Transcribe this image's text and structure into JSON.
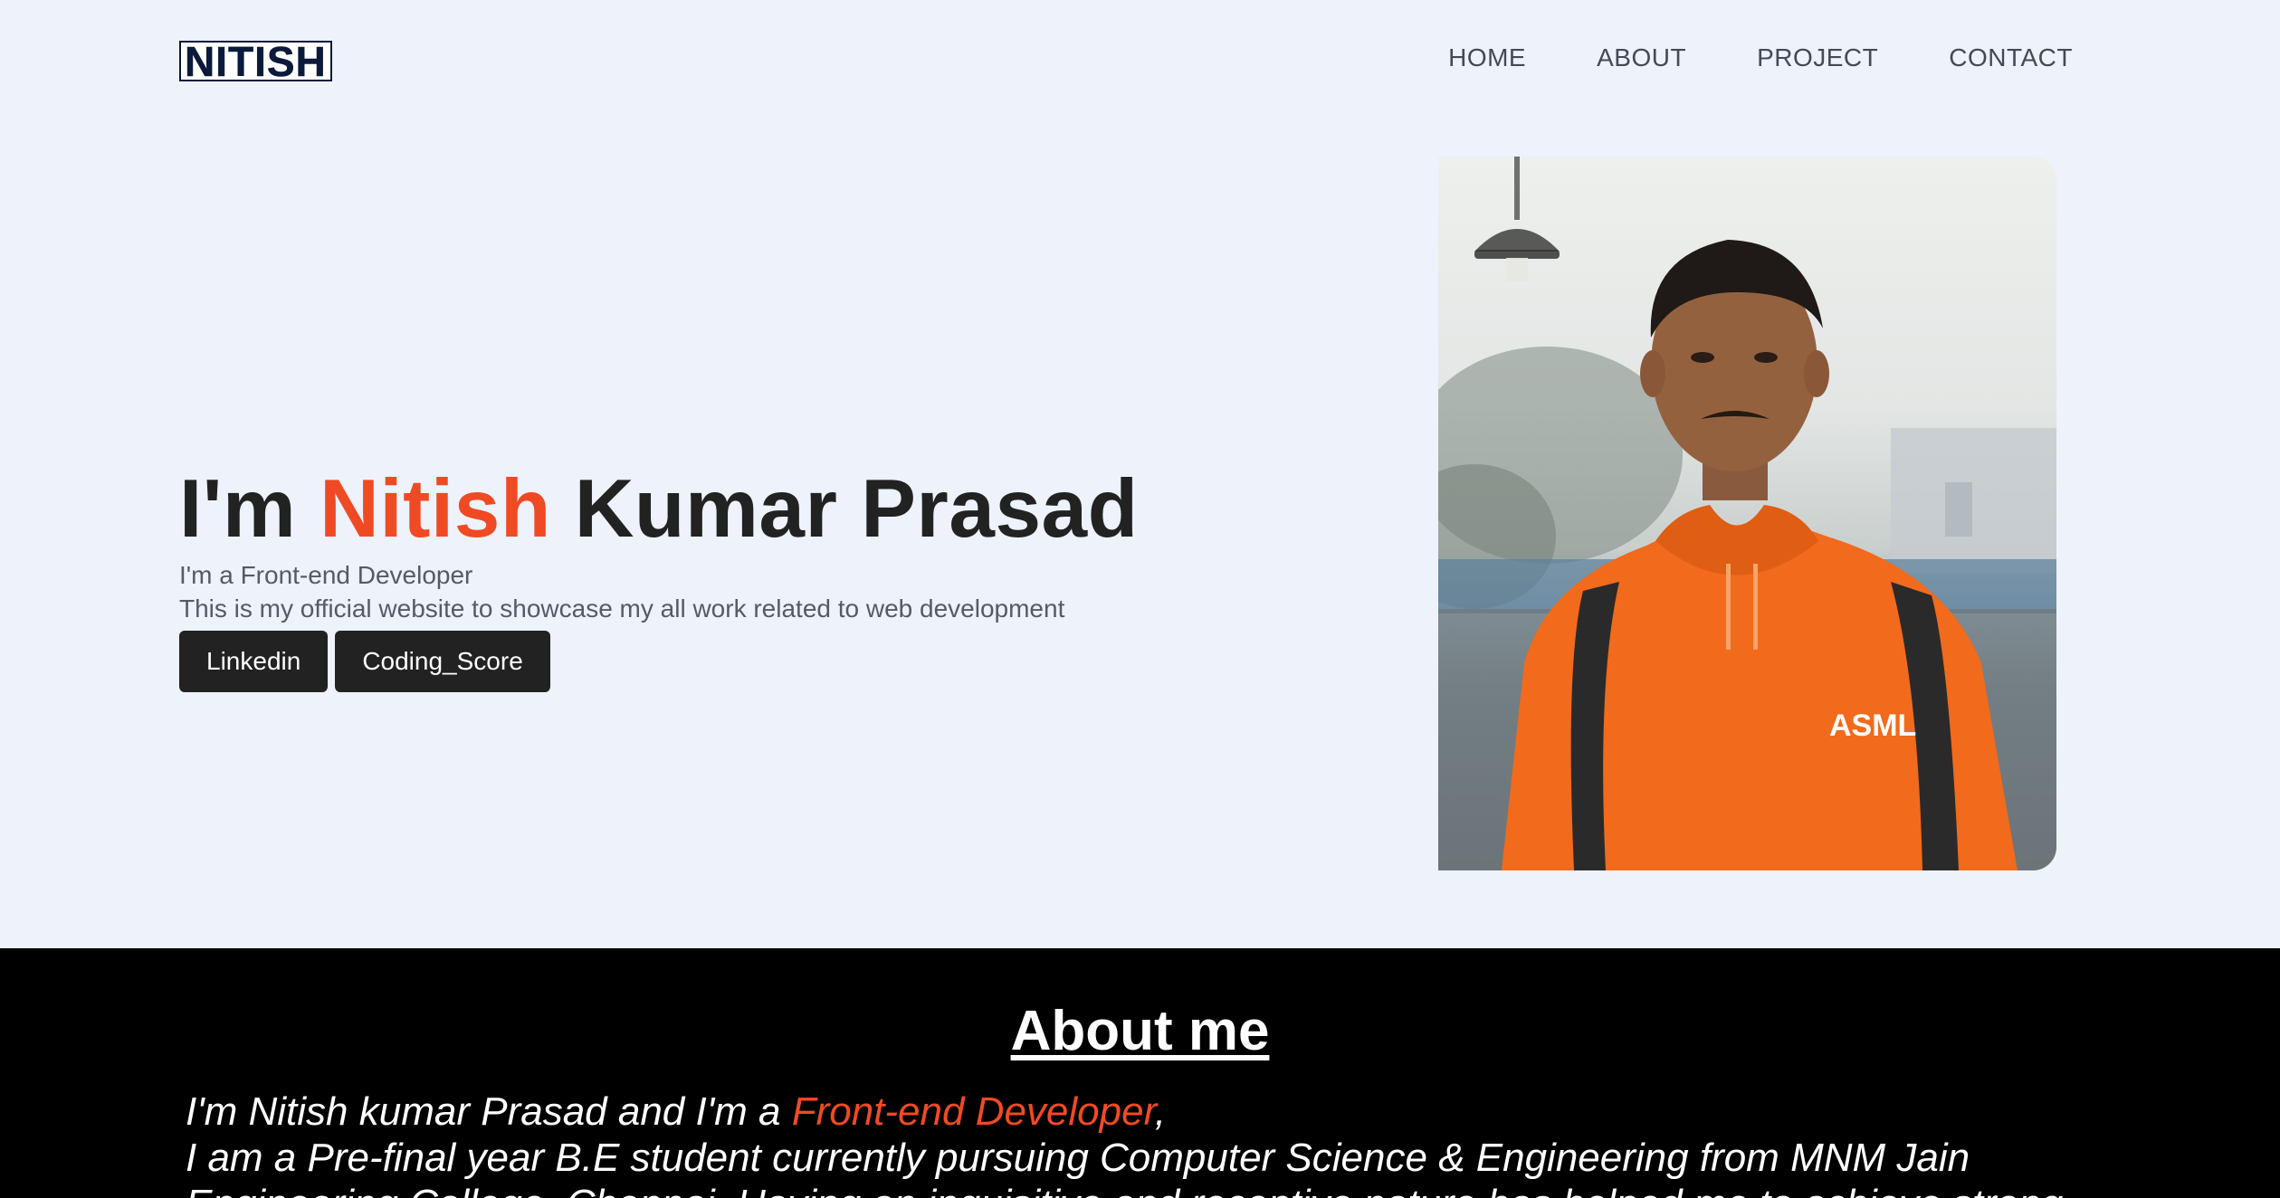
{
  "brand": {
    "logo_text": "NITISH"
  },
  "nav": {
    "items": [
      {
        "label": "HOME"
      },
      {
        "label": "ABOUT"
      },
      {
        "label": "PROJECT"
      },
      {
        "label": "CONTACT"
      }
    ]
  },
  "hero": {
    "title_prefix": "I'm ",
    "title_accent": "Nitish",
    "title_suffix": " Kumar Prasad",
    "role_line": "I'm a Front-end Developer",
    "description": "This is my official website to showcase my all work related to web development",
    "buttons": [
      {
        "label": "Linkedin"
      },
      {
        "label": "Coding_Score"
      }
    ],
    "photo_hoodie_text": "ASML"
  },
  "about": {
    "heading": "About me",
    "line1_prefix": "I'm Nitish kumar Prasad and I'm a ",
    "line1_accent": "Front-end Developer",
    "line1_suffix": ",",
    "line2": "I am a Pre-final year B.E student currently pursuing Computer Science & Engineering from MNM Jain",
    "line3": "Engineering College, Chennai. Having an inquisitive and receptive nature has helped me to achieve strong"
  },
  "colors": {
    "accent": "#f04a24",
    "page_background": "#edf2fb",
    "button_background": "#222222",
    "about_background": "#000000"
  }
}
